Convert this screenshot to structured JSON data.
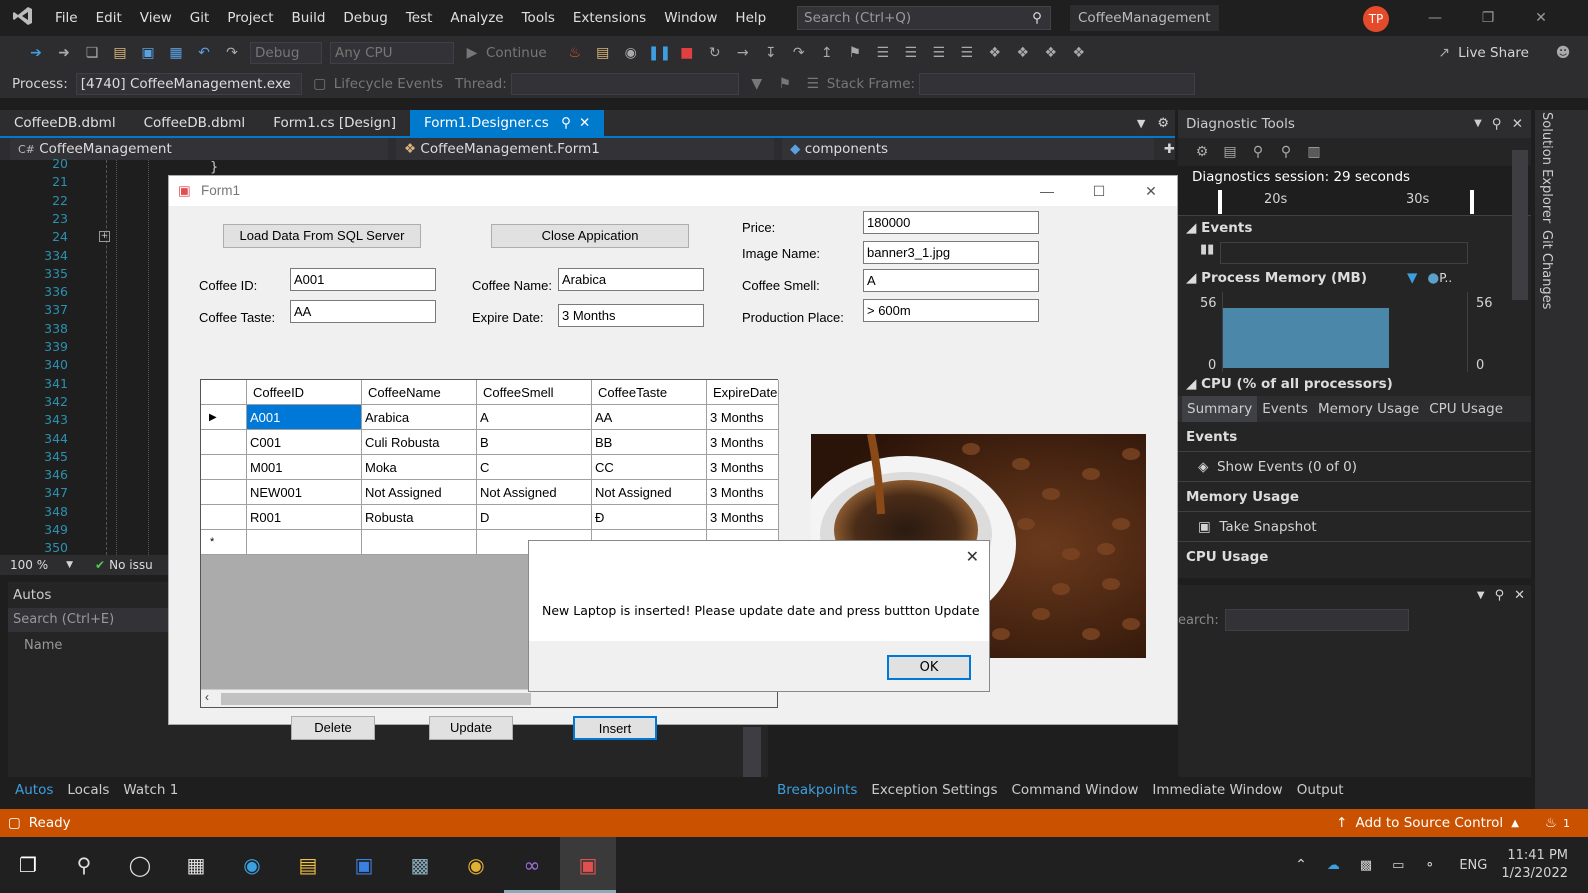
{
  "menubar": {
    "items": [
      "File",
      "Edit",
      "View",
      "Git",
      "Project",
      "Build",
      "Debug",
      "Test",
      "Analyze",
      "Tools",
      "Extensions",
      "Window",
      "Help"
    ],
    "search_placeholder": "Search (Ctrl+Q)",
    "solution_name": "CoffeeManagement",
    "avatar_initials": "TP"
  },
  "toolbar": {
    "config": "Debug",
    "platform": "Any CPU",
    "continue_label": "Continue",
    "live_share": "Live Share",
    "process_label": "Process:",
    "process_value": "[4740] CoffeeManagement.exe",
    "lifecycle_label": "Lifecycle Events",
    "thread_label": "Thread:",
    "stackframe_label": "Stack Frame:"
  },
  "tabs": [
    {
      "label": "CoffeeDB.dbml",
      "active": false
    },
    {
      "label": "CoffeeDB.dbml",
      "active": false
    },
    {
      "label": "Form1.cs [Design]",
      "active": false
    },
    {
      "label": "Form1.Designer.cs",
      "active": true
    }
  ],
  "navbar": {
    "project": "CoffeeManagement",
    "class": "CoffeeManagement.Form1",
    "member": "components"
  },
  "editor": {
    "line_numbers": [
      "20",
      "21",
      "22",
      "23",
      "24",
      "334",
      "335",
      "336",
      "337",
      "338",
      "339",
      "340",
      "341",
      "342",
      "343",
      "344",
      "345",
      "346",
      "347",
      "348",
      "349",
      "350"
    ],
    "zoom": "100 %",
    "issues": "No issu"
  },
  "autos": {
    "title": "Autos",
    "search_placeholder": "Search (Ctrl+E)",
    "column_name": "Name"
  },
  "bottom_tabs_left": [
    "Autos",
    "Locals",
    "Watch 1"
  ],
  "bottom_tabs_right": [
    "Breakpoints",
    "Exception Settings",
    "Command Window",
    "Immediate Window",
    "Output"
  ],
  "diagnostics": {
    "title": "Diagnostic Tools",
    "session": "Diagnostics session: 29 seconds",
    "tick_20": "20s",
    "tick_30": "30s",
    "events_label": "Events",
    "memory_label": "Process Memory (MB)",
    "memory_legend": "P..",
    "mem_max_left": "56",
    "mem_min_left": "0",
    "mem_max_right": "56",
    "mem_min_right": "0",
    "cpu_label": "CPU (% of all processors)",
    "subtabs": [
      "Summary",
      "Events",
      "Memory Usage",
      "CPU Usage"
    ],
    "sec_events": "Events",
    "show_events": "Show Events (0 of 0)",
    "sec_memory": "Memory Usage",
    "take_snapshot": "Take Snapshot",
    "sec_cpu": "CPU Usage",
    "search_label": "earch:"
  },
  "right_strip": [
    "Solution Explorer",
    "Git Changes"
  ],
  "status": {
    "ready": "Ready",
    "add_source": "Add to Source Control",
    "notif_count": "1"
  },
  "taskbar": {
    "lang": "ENG",
    "time": "11:41 PM",
    "date": "1/23/2022"
  },
  "form1": {
    "title": "Form1",
    "load_button": "Load Data From SQL Server",
    "close_button": "Close Appication",
    "labels": {
      "coffee_id": "Coffee ID:",
      "coffee_taste": "Coffee Taste:",
      "coffee_name": "Coffee Name:",
      "expire_date": "Expire Date:",
      "price": "Price:",
      "image_name": "Image Name:",
      "coffee_smell": "Coffee Smell:",
      "production_place": "Production Place:"
    },
    "values": {
      "coffee_id": "A001",
      "coffee_taste": "AA",
      "coffee_name": "Arabica",
      "expire_date": "3 Months",
      "price": "180000",
      "image_name": "banner3_1.jpg",
      "coffee_smell": "A",
      "production_place": "> 600m"
    },
    "grid": {
      "columns": [
        "CoffeeID",
        "CoffeeName",
        "CoffeeSmell",
        "CoffeeTaste",
        "ExpireDate"
      ],
      "rows": [
        [
          "A001",
          "Arabica",
          "A",
          "AA",
          "3 Months"
        ],
        [
          "C001",
          "Culi Robusta",
          "B",
          "BB",
          "3 Months"
        ],
        [
          "M001",
          "Moka",
          "C",
          "CC",
          "3 Months"
        ],
        [
          "NEW001",
          "Not Assigned",
          "Not Assigned",
          "Not Assigned",
          "3 Months"
        ],
        [
          "R001",
          "Robusta",
          "D",
          "Đ",
          "3 Months"
        ]
      ]
    },
    "delete_button": "Delete",
    "update_button": "Update",
    "insert_button": "Insert"
  },
  "msgbox": {
    "message": "New Laptop is inserted! Please update date and press buttton Update",
    "ok": "OK"
  }
}
